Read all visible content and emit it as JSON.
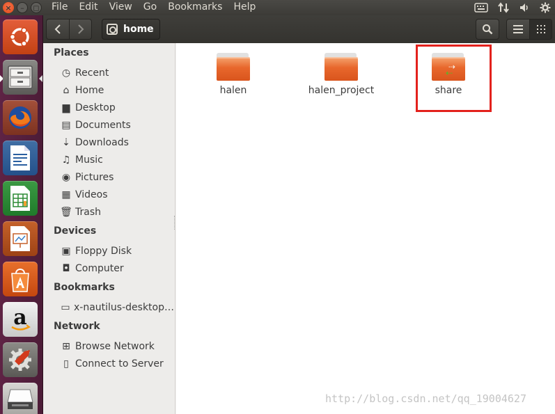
{
  "menubar": {
    "items": [
      "File",
      "Edit",
      "View",
      "Go",
      "Bookmarks",
      "Help"
    ],
    "window_buttons": {
      "close": "×",
      "minimize": "–",
      "maximize": "◻"
    },
    "tray_icons": [
      "keyboard-icon",
      "network-arrows-icon",
      "volume-icon",
      "settings-gear-icon"
    ]
  },
  "launcher": {
    "apps": [
      "ubuntu-dash-icon",
      "files-icon",
      "firefox-icon",
      "libreoffice-writer-icon",
      "libreoffice-calc-icon",
      "libreoffice-impress-icon",
      "software-center-icon",
      "amazon-icon",
      "system-settings-icon",
      "trash-drive-icon"
    ],
    "colors": {
      "background": "#5e2344"
    }
  },
  "toolbar": {
    "back": "‹",
    "forward": "›",
    "location": "home",
    "search_icon": "⌕",
    "list_view": "≡",
    "grid_view": "⋮⋮"
  },
  "sidebar": {
    "places_title": "Places",
    "places": [
      {
        "icon": "◷",
        "label": "Recent"
      },
      {
        "icon": "⌂",
        "label": "Home"
      },
      {
        "icon": "▆",
        "label": "Desktop"
      },
      {
        "icon": "▤",
        "label": "Documents"
      },
      {
        "icon": "⇣",
        "label": "Downloads"
      },
      {
        "icon": "♫",
        "label": "Music"
      },
      {
        "icon": "◉",
        "label": "Pictures"
      },
      {
        "icon": "▦",
        "label": "Videos"
      },
      {
        "icon": "🗑",
        "label": "Trash"
      }
    ],
    "devices_title": "Devices",
    "devices": [
      {
        "icon": "▣",
        "label": "Floppy Disk"
      },
      {
        "icon": "◘",
        "label": "Computer"
      }
    ],
    "bookmarks_title": "Bookmarks",
    "bookmarks": [
      {
        "icon": "▭",
        "label": "x-nautilus-desktop…"
      }
    ],
    "network_title": "Network",
    "network": [
      {
        "icon": "⊞",
        "label": "Browse Network"
      },
      {
        "icon": "▯",
        "label": "Connect to Server"
      }
    ]
  },
  "files": [
    {
      "name": "halen",
      "type": "folder"
    },
    {
      "name": "halen_project",
      "type": "folder"
    },
    {
      "name": "share",
      "type": "shared-folder"
    }
  ],
  "watermark": "http://blog.csdn.net/qq_19004627",
  "colors": {
    "accent": "#e8672c",
    "highlight": "#e3211c",
    "toolbar": "#3c3b37"
  }
}
